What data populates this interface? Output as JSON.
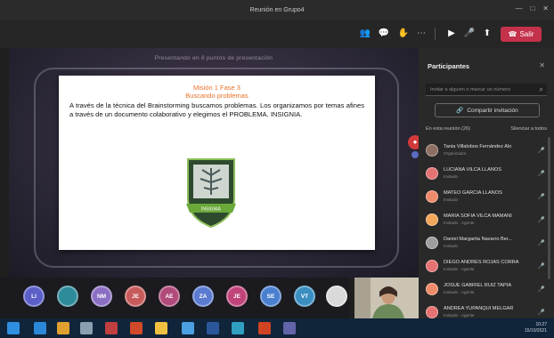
{
  "window": {
    "title": "Reunión en Grupo4",
    "controls": [
      "—",
      "□",
      "✕"
    ]
  },
  "toolbar": {
    "leave_label": "Salir",
    "tools": [
      {
        "icon": "participants-icon",
        "glyph": "👥",
        "color": "#cfcfcf"
      },
      {
        "icon": "chat-icon",
        "glyph": "💬",
        "color": "#cfcfcf"
      },
      {
        "icon": "raise-hand-icon",
        "glyph": "✋",
        "color": "#cfcfcf"
      },
      {
        "icon": "more-options-icon",
        "glyph": "⋯",
        "color": "#cfcfcf"
      },
      {
        "icon": "camera-icon",
        "glyph": "▶",
        "color": "#ffffff"
      },
      {
        "icon": "microphone-icon",
        "glyph": "🎤",
        "color": "#ffffff"
      },
      {
        "icon": "share-screen-icon",
        "glyph": "⬆",
        "color": "#ffffff"
      }
    ]
  },
  "stage": {
    "banner": "Presentando en 8 puntos de presentación"
  },
  "slide": {
    "heading_1": "Misión 1 Fase 3",
    "heading_2": "Buscando problemas",
    "body": "A través de la técnica del Brainstorming buscamos problemas. Los organizamos por temas afines a través de un documento colaborativo y elegimos el PROBLEMA. INSIGNIA.",
    "badge_text": "INSIGNIA"
  },
  "avatars": [
    {
      "initials": "LI",
      "color": "#5b5fc7"
    },
    {
      "initials": "",
      "color": "#2e8b9a"
    },
    {
      "initials": "NM",
      "color": "#8b6fc4"
    },
    {
      "initials": "JE",
      "color": "#c75b5b"
    },
    {
      "initials": "AE",
      "color": "#b04a7a"
    },
    {
      "initials": "ZA",
      "color": "#5a7bd0"
    },
    {
      "initials": "JE",
      "color": "#c0447a"
    },
    {
      "initials": "SE",
      "color": "#4a7fd0"
    },
    {
      "initials": "VT",
      "color": "#3a8fc0"
    },
    {
      "initials": "",
      "color": "#d9d9d9"
    }
  ],
  "panel": {
    "title": "Participantes",
    "close": "✕",
    "search_placeholder": "Invitar a alguien o marcar un número",
    "share_label": "Compartir invitación",
    "section_label": "En esta reunión (26)",
    "mute_all_label": "Silenciar a todos",
    "participants": [
      {
        "name": "Tania Villalobos Fernández Alo",
        "sub": "Organizador",
        "color": "#8d6e63",
        "mic": "🎤"
      },
      {
        "name": "LUCIANA VILCA LLANOS",
        "sub": "Invitado",
        "color": "#e57373",
        "mic": "🎤"
      },
      {
        "name": "MATEO GARCÍA LLANOS",
        "sub": "Invitado",
        "color": "#ef8a6a",
        "mic": "🎤"
      },
      {
        "name": "MARÍA SOFÍA VILCA MAMANI",
        "sub": "Invitado · Agente",
        "color": "#f2a65a",
        "mic": "🎤"
      },
      {
        "name": "Daniel Margarita Navarro Ber...",
        "sub": "Invitado",
        "color": "#9e9e9e",
        "mic": "🎤"
      },
      {
        "name": "DIEGO ANDRÉS ROJAS CORRA",
        "sub": "Invitado · Agente",
        "color": "#e57373",
        "mic": "🎤"
      },
      {
        "name": "JOSUÉ GABRIEL RUIZ TAPIA",
        "sub": "Invitado · Agente",
        "color": "#ef8a6a",
        "mic": "🎤"
      },
      {
        "name": "ANDREA YUPANQUI MELGAR",
        "sub": "Invitado · Agente",
        "color": "#e57373",
        "mic": "🎤"
      }
    ]
  },
  "taskbar": {
    "apps": [
      {
        "name": "start-icon",
        "color": "#2f8fe0"
      },
      {
        "name": "edge-icon",
        "color": "#2b88d8"
      },
      {
        "name": "chrome-icon",
        "color": "#e0a030"
      },
      {
        "name": "settings-icon",
        "color": "#8aa0b0"
      },
      {
        "name": "media-icon",
        "color": "#c04040"
      },
      {
        "name": "office-icon",
        "color": "#d04a2a"
      },
      {
        "name": "files-icon",
        "color": "#f0c040"
      },
      {
        "name": "photos-icon",
        "color": "#4aa0e0"
      },
      {
        "name": "word-icon",
        "color": "#2b579a"
      },
      {
        "name": "store-icon",
        "color": "#30a0c0"
      },
      {
        "name": "powerpoint-icon",
        "color": "#d04423"
      },
      {
        "name": "teams-icon",
        "color": "#6264a7"
      }
    ],
    "tray_time": "10:27",
    "tray_date": "15/10/2021"
  }
}
